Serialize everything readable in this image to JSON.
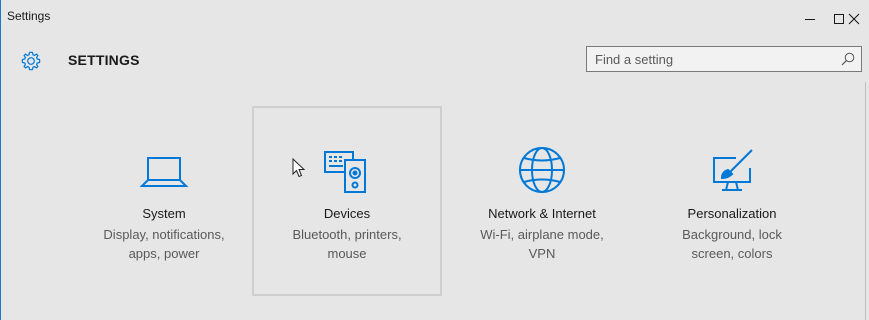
{
  "window": {
    "title": "Settings"
  },
  "header": {
    "title": "SETTINGS",
    "search_placeholder": "Find a setting"
  },
  "tiles": [
    {
      "label": "System",
      "desc_line1": "Display, notifications,",
      "desc_line2": "apps, power",
      "icon": "laptop-icon"
    },
    {
      "label": "Devices",
      "desc_line1": "Bluetooth, printers,",
      "desc_line2": "mouse",
      "icon": "devices-icon"
    },
    {
      "label": "Network & Internet",
      "desc_line1": "Wi-Fi, airplane mode,",
      "desc_line2": "VPN",
      "icon": "globe-icon"
    },
    {
      "label": "Personalization",
      "desc_line1": "Background, lock",
      "desc_line2": "screen, colors",
      "icon": "paintbrush-icon"
    }
  ],
  "colors": {
    "accent": "#0078d7",
    "background": "#e6e6e6",
    "hover_border": "#cfcfcf"
  }
}
